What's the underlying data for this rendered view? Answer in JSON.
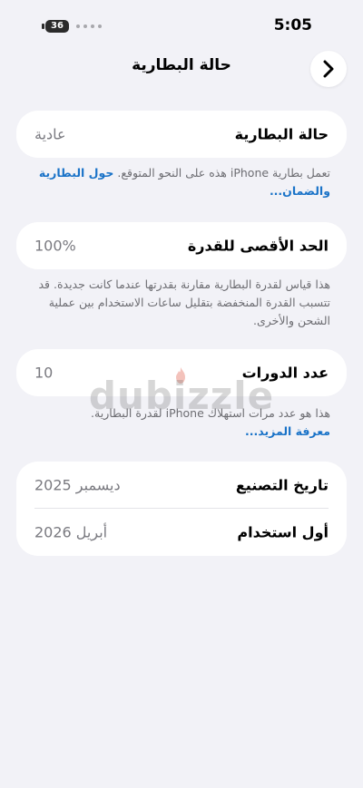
{
  "status_bar": {
    "time": "5:05",
    "battery": "36"
  },
  "header": {
    "title": "حالة البطارية"
  },
  "battery_health": {
    "label": "حالة البطارية",
    "value": "عادية",
    "footnote": "تعمل بطارية iPhone هذه على النحو المتوقع.",
    "footnote_link": "حول البطارية والضمان..."
  },
  "max_capacity": {
    "label": "الحد الأقصى للقدرة",
    "value": "100%",
    "footnote": "هذا قياس لقدرة البطارية مقارنة بقدرتها عندما كانت جديدة. قد تتسبب القدرة المنخفضة بتقليل ساعات الاستخدام بين عملية الشحن والأخرى."
  },
  "cycle_count": {
    "label": "عدد الدورات",
    "value": "10",
    "footnote": "هذا هو عدد مرات استهلاك iPhone لقدرة البطارية.",
    "footnote_link": "معرفة المزيد..."
  },
  "dates": {
    "manufacture_label": "تاريخ التصنيع",
    "manufacture_value": "ديسمبر 2025",
    "first_use_label": "أول استخدام",
    "first_use_value": "أبريل 2026"
  },
  "watermark": "dubizzle"
}
